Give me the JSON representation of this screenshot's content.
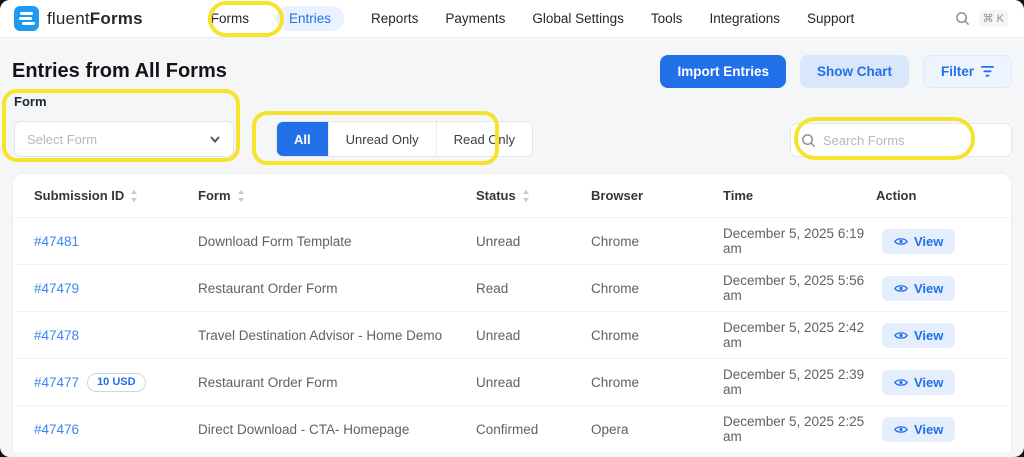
{
  "brand": {
    "light": "fluent",
    "bold": "Forms"
  },
  "nav": {
    "items": [
      {
        "label": "Forms"
      },
      {
        "label": "Entries",
        "active": true
      },
      {
        "label": "Reports"
      },
      {
        "label": "Payments"
      },
      {
        "label": "Global Settings"
      },
      {
        "label": "Tools"
      },
      {
        "label": "Integrations"
      },
      {
        "label": "Support"
      }
    ],
    "shortcut": "⌘ K"
  },
  "page": {
    "title": "Entries from All Forms"
  },
  "actions": {
    "import_entries": "Import Entries",
    "show_chart": "Show Chart",
    "filter": "Filter"
  },
  "filters": {
    "form_label": "Form",
    "form_select_placeholder": "Select Form",
    "tabs": [
      "All",
      "Unread Only",
      "Read Only"
    ],
    "active_tab": "All",
    "search_placeholder": "Search Forms"
  },
  "table": {
    "columns": [
      {
        "label": "Submission ID",
        "sortable": true
      },
      {
        "label": "Form",
        "sortable": true
      },
      {
        "label": "Status",
        "sortable": true
      },
      {
        "label": "Browser",
        "sortable": false
      },
      {
        "label": "Time",
        "sortable": false
      },
      {
        "label": "Action",
        "sortable": false
      }
    ],
    "view_label": "View",
    "rows": [
      {
        "id": "#47481",
        "badge": null,
        "form": "Download Form Template",
        "status": "Unread",
        "browser": "Chrome",
        "time": "December 5, 2025 6:19 am"
      },
      {
        "id": "#47479",
        "badge": null,
        "form": "Restaurant Order Form",
        "status": "Read",
        "browser": "Chrome",
        "time": "December 5, 2025 5:56 am"
      },
      {
        "id": "#47478",
        "badge": null,
        "form": "Travel Destination Advisor - Home Demo",
        "status": "Unread",
        "browser": "Chrome",
        "time": "December 5, 2025 2:42 am"
      },
      {
        "id": "#47477",
        "badge": "10 USD",
        "form": "Restaurant Order Form",
        "status": "Unread",
        "browser": "Chrome",
        "time": "December 5, 2025 2:39 am"
      },
      {
        "id": "#47476",
        "badge": null,
        "form": "Direct Download - CTA- Homepage",
        "status": "Confirmed",
        "browser": "Opera",
        "time": "December 5, 2025 2:25 am"
      }
    ]
  },
  "colors": {
    "primary_blue": "#2270e8",
    "logo_blue": "#1e9bf0",
    "annotation_yellow": "#f6e32b",
    "soft_blue_bg": "#d9e7fb",
    "view_pill_bg": "#e4eefc",
    "link_blue": "#3b86ee"
  }
}
